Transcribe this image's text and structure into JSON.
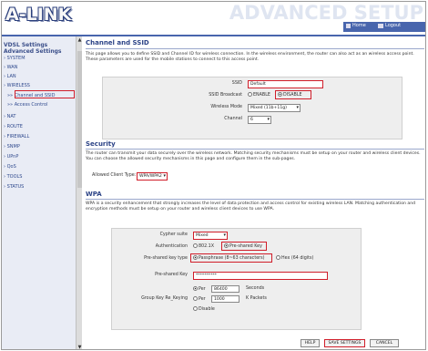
{
  "header": {
    "logo": "A-LINK",
    "section": "ADVANCED SETUP",
    "home": "Home",
    "logout": "Logout"
  },
  "sidebar": {
    "items": [
      {
        "label": "VDSL Settings",
        "type": "header"
      },
      {
        "label": "Advanced Settings",
        "type": "header"
      },
      {
        "label": "› SYSTEM"
      },
      {
        "label": "› WAN"
      },
      {
        "label": "› LAN"
      },
      {
        "label": "› WIRELESS"
      },
      {
        "label": "Channel and SSID",
        "active": true
      },
      {
        "label": "Access Control"
      },
      {
        "label": "› NAT"
      },
      {
        "label": "› ROUTE"
      },
      {
        "label": "› FIREWALL"
      },
      {
        "label": "› SNMP"
      },
      {
        "label": "› UPnP"
      },
      {
        "label": "› QoS"
      },
      {
        "label": "› TOOLS"
      },
      {
        "label": "› STATUS"
      }
    ]
  },
  "channel": {
    "title": "Channel and SSID",
    "desc": "This page allows you to define SSID and Channel ID for wireless connection. In the wireless environment, the router can also act as an wireless access point. These parameters are used for the mobile stations to connect to this access point.",
    "ssid_label": "SSID",
    "ssid_value": "Default",
    "broadcast_label": "SSID Broadcast",
    "enable": "ENABLE",
    "disable": "DISABLE",
    "mode_label": "Wireless Mode",
    "mode_value": "Mixed (11b+11g)",
    "channel_label": "Channel",
    "channel_value": "6"
  },
  "security": {
    "title": "Security",
    "desc": "The router can transmit your data securely over the wireless network. Matching security mechanisms must be setup on your router and wireless client devices. You can choose the allowed security mechanisms in this page and configure them in the sub-pages.",
    "client_type_label": "Allowed Client Type:",
    "client_type_value": "WPA/WPA2"
  },
  "wpa": {
    "title": "WPA",
    "desc": "WPA is a security enhancement that strongly increases the level of data protection and access control for existing wireless LAN. Matching authentication and encryption methods must be setup on your router and wireless client devices to use WPA.",
    "cypher_label": "Cypher suite",
    "cypher_value": "Mixed",
    "auth_label": "Authentication",
    "auth_8021x": "802.1X",
    "auth_psk": "Pre-shared Key",
    "psk_type_label": "Pre-shared key type",
    "psk_passphrase": "Passphrase (8~63 characters)",
    "psk_hex": "Hex (64 digits)",
    "psk_label": "Pre-shared Key",
    "psk_value": "**********",
    "rekey_label": "Group Key Re_Keying",
    "rekey_per_label": "Per",
    "rekey_seconds_value": "86400",
    "rekey_seconds_unit": "Seconds",
    "rekey_packets_value": "1000",
    "rekey_packets_unit": "K Packets",
    "rekey_disable": "Disable"
  },
  "buttons": {
    "help": "HELP",
    "save": "SAVE SETTINGS",
    "cancel": "CANCEL"
  },
  "colors": {
    "accent": "#4865ad",
    "highlight": "#d01e2a",
    "title": "#2d4487"
  }
}
